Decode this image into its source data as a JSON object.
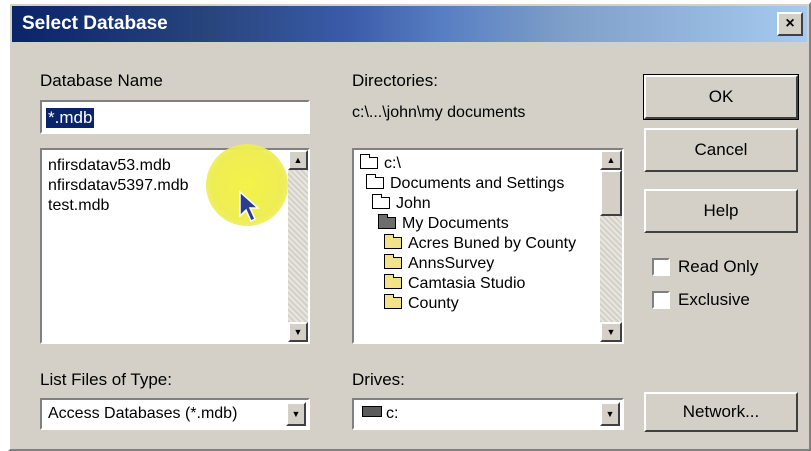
{
  "window": {
    "title": "Select Database",
    "close_label": "×"
  },
  "database_name": {
    "label": "Database Name",
    "value": "*.mdb",
    "files": [
      "nfirsdatav53.mdb",
      "nfirsdatav5397.mdb",
      "test.mdb"
    ]
  },
  "directories": {
    "label": "Directories:",
    "current_path": "c:\\...\\john\\my documents",
    "items": [
      {
        "label": "c:\\",
        "icon": "open-folder-icon"
      },
      {
        "label": "Documents and Settings",
        "icon": "open-folder-icon"
      },
      {
        "label": "John",
        "icon": "open-folder-icon"
      },
      {
        "label": "My Documents",
        "icon": "open-folder-icon"
      },
      {
        "label": "Acres Buned by County",
        "icon": "folder-icon"
      },
      {
        "label": "AnnsSurvey",
        "icon": "folder-icon"
      },
      {
        "label": "Camtasia Studio",
        "icon": "folder-icon"
      },
      {
        "label": "County",
        "icon": "folder-icon"
      }
    ]
  },
  "buttons": {
    "ok": "OK",
    "cancel": "Cancel",
    "help": "Help",
    "network": "Network..."
  },
  "options": {
    "read_only": "Read Only",
    "exclusive": "Exclusive"
  },
  "file_type": {
    "label": "List Files of Type:",
    "value": "Access Databases (*.mdb)"
  },
  "drives": {
    "label": "Drives:",
    "value": "c:"
  }
}
